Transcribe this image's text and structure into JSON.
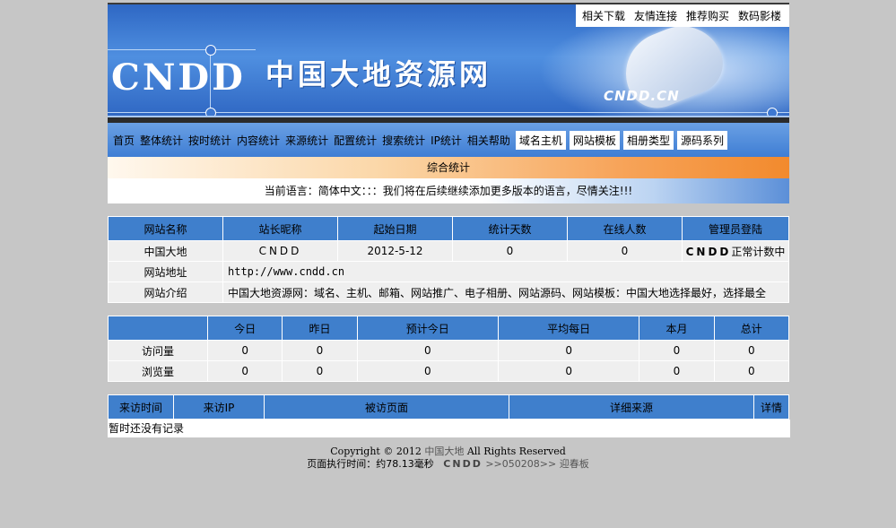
{
  "banner": {
    "logo": "CNDD",
    "title": "中国大地资源网",
    "sub_logo": "CNDD.CN",
    "top_links": [
      "相关下载",
      "友情连接",
      "推荐购买",
      "数码影楼"
    ]
  },
  "nav": {
    "items": [
      "首页",
      "整体统计",
      "按时统计",
      "内容统计",
      "来源统计",
      "配置统计",
      "搜索统计",
      "IP统计",
      "相关帮助"
    ],
    "boxed": [
      "域名主机",
      "网站模板",
      "相册类型",
      "源码系列"
    ]
  },
  "section_title": "综合统计",
  "language_line": "当前语言：简体中文：：：我们将在后续继续添加更多版本的语言，尽情关注!!!",
  "site_table": {
    "headers": [
      "网站名称",
      "站长昵称",
      "起始日期",
      "统计天数",
      "在线人数",
      "管理员登陆"
    ],
    "row": [
      "中国大地",
      "CNDD",
      "2012-5-12",
      "0",
      "0",
      "CNDD正常计数中"
    ],
    "url_label": "网站地址",
    "url_value": "http://www.cndd.cn",
    "intro_label": "网站介绍",
    "intro_value": "中国大地资源网：域名、主机、邮箱、网站推广、电子相册、网站源码、网站模板：中国大地选择最好，选择最全"
  },
  "stats_table": {
    "headers": [
      "",
      "今日",
      "昨日",
      "预计今日",
      "平均每日",
      "本月",
      "总计"
    ],
    "rows": [
      {
        "label": "访问量",
        "values": [
          "0",
          "0",
          "0",
          "0",
          "0",
          "0"
        ]
      },
      {
        "label": "浏览量",
        "values": [
          "0",
          "0",
          "0",
          "0",
          "0",
          "0"
        ]
      }
    ]
  },
  "visit_table": {
    "headers": [
      "来访时间",
      "来访IP",
      "被访页面",
      "详细来源",
      "详情"
    ],
    "empty": "暂时还没有记录"
  },
  "footer": {
    "copyright_pre": "Copyright © 2012",
    "copyright_link": "中国大地",
    "copyright_post": "All Rights Reserved",
    "exec_time": "页面执行时间：约78.13毫秒",
    "brand": "CNDD",
    "version": ">>050208>>",
    "template": "迎春板"
  }
}
